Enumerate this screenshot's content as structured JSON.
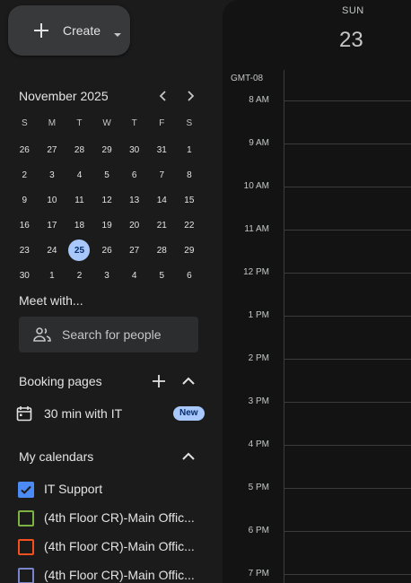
{
  "create": {
    "label": "Create"
  },
  "mini_calendar": {
    "title": "November 2025",
    "weekdays": [
      "S",
      "M",
      "T",
      "W",
      "T",
      "F",
      "S"
    ],
    "weeks": [
      [
        "26",
        "27",
        "28",
        "29",
        "30",
        "31",
        "1"
      ],
      [
        "2",
        "3",
        "4",
        "5",
        "6",
        "7",
        "8"
      ],
      [
        "9",
        "10",
        "11",
        "12",
        "13",
        "14",
        "15"
      ],
      [
        "16",
        "17",
        "18",
        "19",
        "20",
        "21",
        "22"
      ],
      [
        "23",
        "24",
        "25",
        "26",
        "27",
        "28",
        "29"
      ],
      [
        "30",
        "1",
        "2",
        "3",
        "4",
        "5",
        "6"
      ]
    ],
    "today": "25"
  },
  "meet_with": {
    "title": "Meet with...",
    "placeholder": "Search for people"
  },
  "booking": {
    "title": "Booking pages",
    "item": "30 min with IT",
    "badge": "New"
  },
  "my_calendars": {
    "title": "My calendars",
    "items": [
      {
        "label": "IT Support",
        "color": "#4c8bf5",
        "checked": true
      },
      {
        "label": "(4th Floor CR)-Main Offic...",
        "color": "#7cb342",
        "checked": false
      },
      {
        "label": "(4th Floor CR)-Main Offic...",
        "color": "#f4511e",
        "checked": false
      },
      {
        "label": "(4th Floor CR)-Main Offic...",
        "color": "#7986cb",
        "checked": false
      }
    ]
  },
  "day_view": {
    "day_name": "SUN",
    "day_number": "23",
    "timezone": "GMT-08",
    "hours": [
      "8 AM",
      "9 AM",
      "10 AM",
      "11 AM",
      "12 PM",
      "1 PM",
      "2 PM",
      "3 PM",
      "4 PM",
      "5 PM",
      "6 PM",
      "7 PM"
    ]
  }
}
